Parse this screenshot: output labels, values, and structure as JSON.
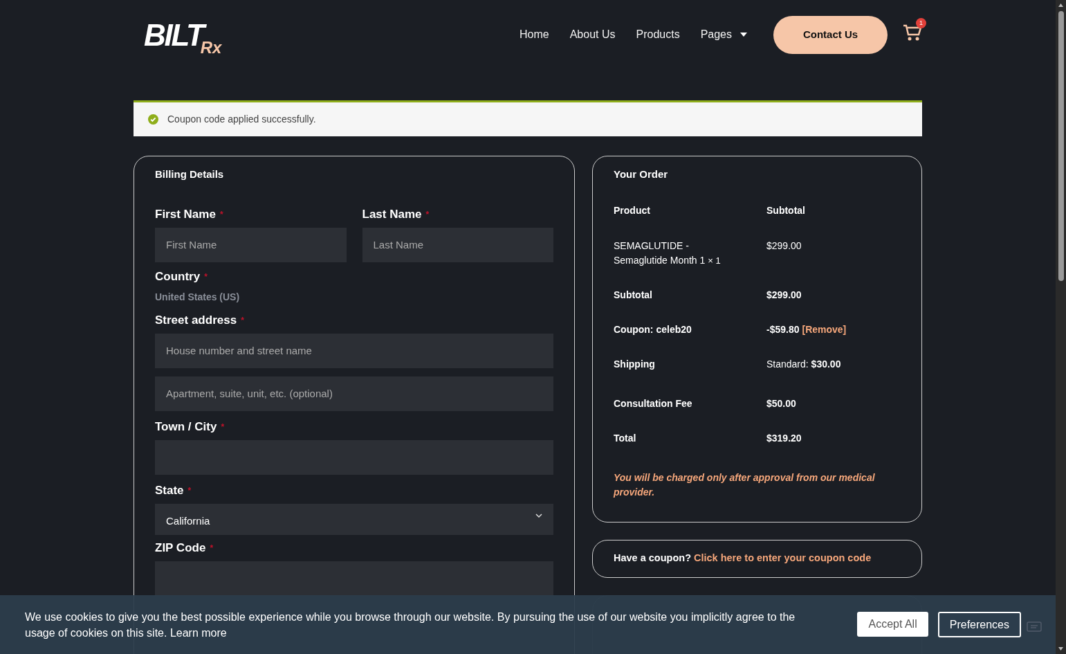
{
  "header": {
    "logo_main": "BILT",
    "logo_sub": "Rx",
    "nav": [
      {
        "label": "Home",
        "dropdown": false
      },
      {
        "label": "About Us",
        "dropdown": false
      },
      {
        "label": "Products",
        "dropdown": false
      },
      {
        "label": "Pages",
        "dropdown": true
      }
    ],
    "contact_button": "Contact Us",
    "cart_count": "1"
  },
  "notice": {
    "text": "Coupon code applied successfully."
  },
  "billing": {
    "title": "Billing Details",
    "name_row": [
      {
        "kind": "text",
        "label": "First Name",
        "required_mark": "*",
        "placeholder": "First Name"
      },
      {
        "kind": "text",
        "label": "Last Name",
        "required_mark": "*",
        "placeholder": "Last Name"
      }
    ],
    "fields": [
      {
        "kind": "static",
        "label": "Country",
        "required_mark": "*",
        "value": "United States (US)"
      },
      {
        "kind": "text",
        "label": "Street address",
        "required_mark": "*",
        "placeholder": "House number and street name"
      },
      {
        "kind": "text",
        "placeholder": "Apartment, suite, unit, etc. (optional)"
      },
      {
        "kind": "text",
        "label": "Town / City",
        "required_mark": "*"
      },
      {
        "kind": "select",
        "label": "State",
        "required_mark": "*",
        "value": "California"
      },
      {
        "kind": "text",
        "label": "ZIP Code",
        "required_mark": "*"
      }
    ]
  },
  "order": {
    "title": "Your Order",
    "columns": [
      "Product",
      "Subtotal"
    ],
    "rows": [
      {
        "kind": "item",
        "label": "SEMAGLUTIDE - Semaglutide Month 1",
        "quantity": "× 1",
        "value": "$299.00"
      },
      {
        "kind": "total",
        "label": "Subtotal",
        "value": "$299.00"
      },
      {
        "kind": "coupon",
        "label": "Coupon: celeb20",
        "value": "-$59.80",
        "link": "[Remove]"
      },
      {
        "kind": "shipping",
        "label": "Shipping",
        "value": "Standard: **$30.00**"
      },
      {
        "kind": "total",
        "label": "Consultation Fee",
        "value": "$50.00"
      },
      {
        "kind": "total",
        "label": "Total",
        "value": "$319.20"
      }
    ],
    "note": "You will be charged only after approval from our medical provider."
  },
  "coupon_prompt": {
    "text": "Have a coupon?",
    "link": "Click here to enter your coupon code"
  },
  "cookie_banner": {
    "text": "We use cookies to give you the best possible experience while you browse through our website. By pursuing the use of our website you implicitly agree to the usage of cookies on this site.",
    "link": "Learn more",
    "buttons": [
      "Accept All",
      "Preferences"
    ]
  }
}
